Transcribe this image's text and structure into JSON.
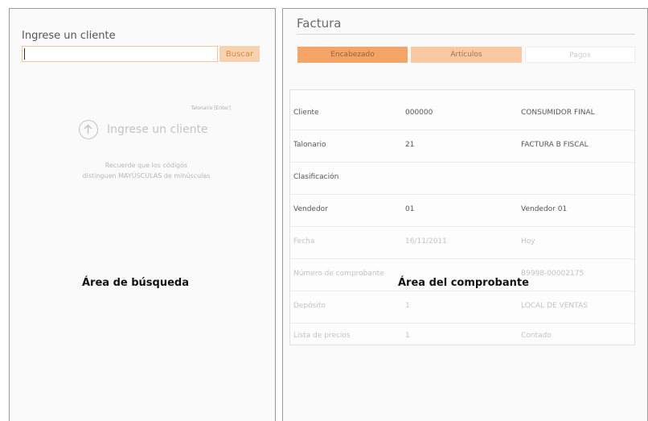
{
  "search": {
    "title": "Ingrese un cliente",
    "input_value": "",
    "button_label": "Buscar",
    "hint": "Talonario [Enter]",
    "empty_title": "Ingrese un cliente",
    "empty_note_line1": "Recuerde que los códigos",
    "empty_note_line2": "distinguen MAYÚSCULAS de minúsculas",
    "area_label": "Área de búsqueda",
    "empty_icon": "arrow-up-circle-icon"
  },
  "invoice": {
    "title": "Factura",
    "tabs": [
      {
        "label": "Encabezado"
      },
      {
        "label": "Artículos"
      },
      {
        "label": "Pagos"
      }
    ],
    "area_label": "Área del comprobante",
    "fields": [
      {
        "label": "Cliente",
        "code": "000000",
        "desc": "CONSUMIDOR FINAL"
      },
      {
        "label": "Talonario",
        "code": "21",
        "desc": "FACTURA B FISCAL"
      },
      {
        "label": "Clasificación",
        "code": "",
        "desc": ""
      },
      {
        "label": "Vendedor",
        "code": "01",
        "desc": "Vendedor 01"
      },
      {
        "label": "Fecha",
        "code": "16/11/2011",
        "desc": "Hoy"
      },
      {
        "label": "Número de comprobante",
        "code": "",
        "desc": "B9998-00002175"
      },
      {
        "label": "Depósito",
        "code": "1",
        "desc": "LOCAL DE VENTAS"
      },
      {
        "label": "Lista de precios",
        "code": "1",
        "desc": "Contado"
      }
    ]
  },
  "colors": {
    "accent": "#f5a467",
    "accent_light": "#f8c9a0",
    "input_border": "#f3c49a"
  }
}
